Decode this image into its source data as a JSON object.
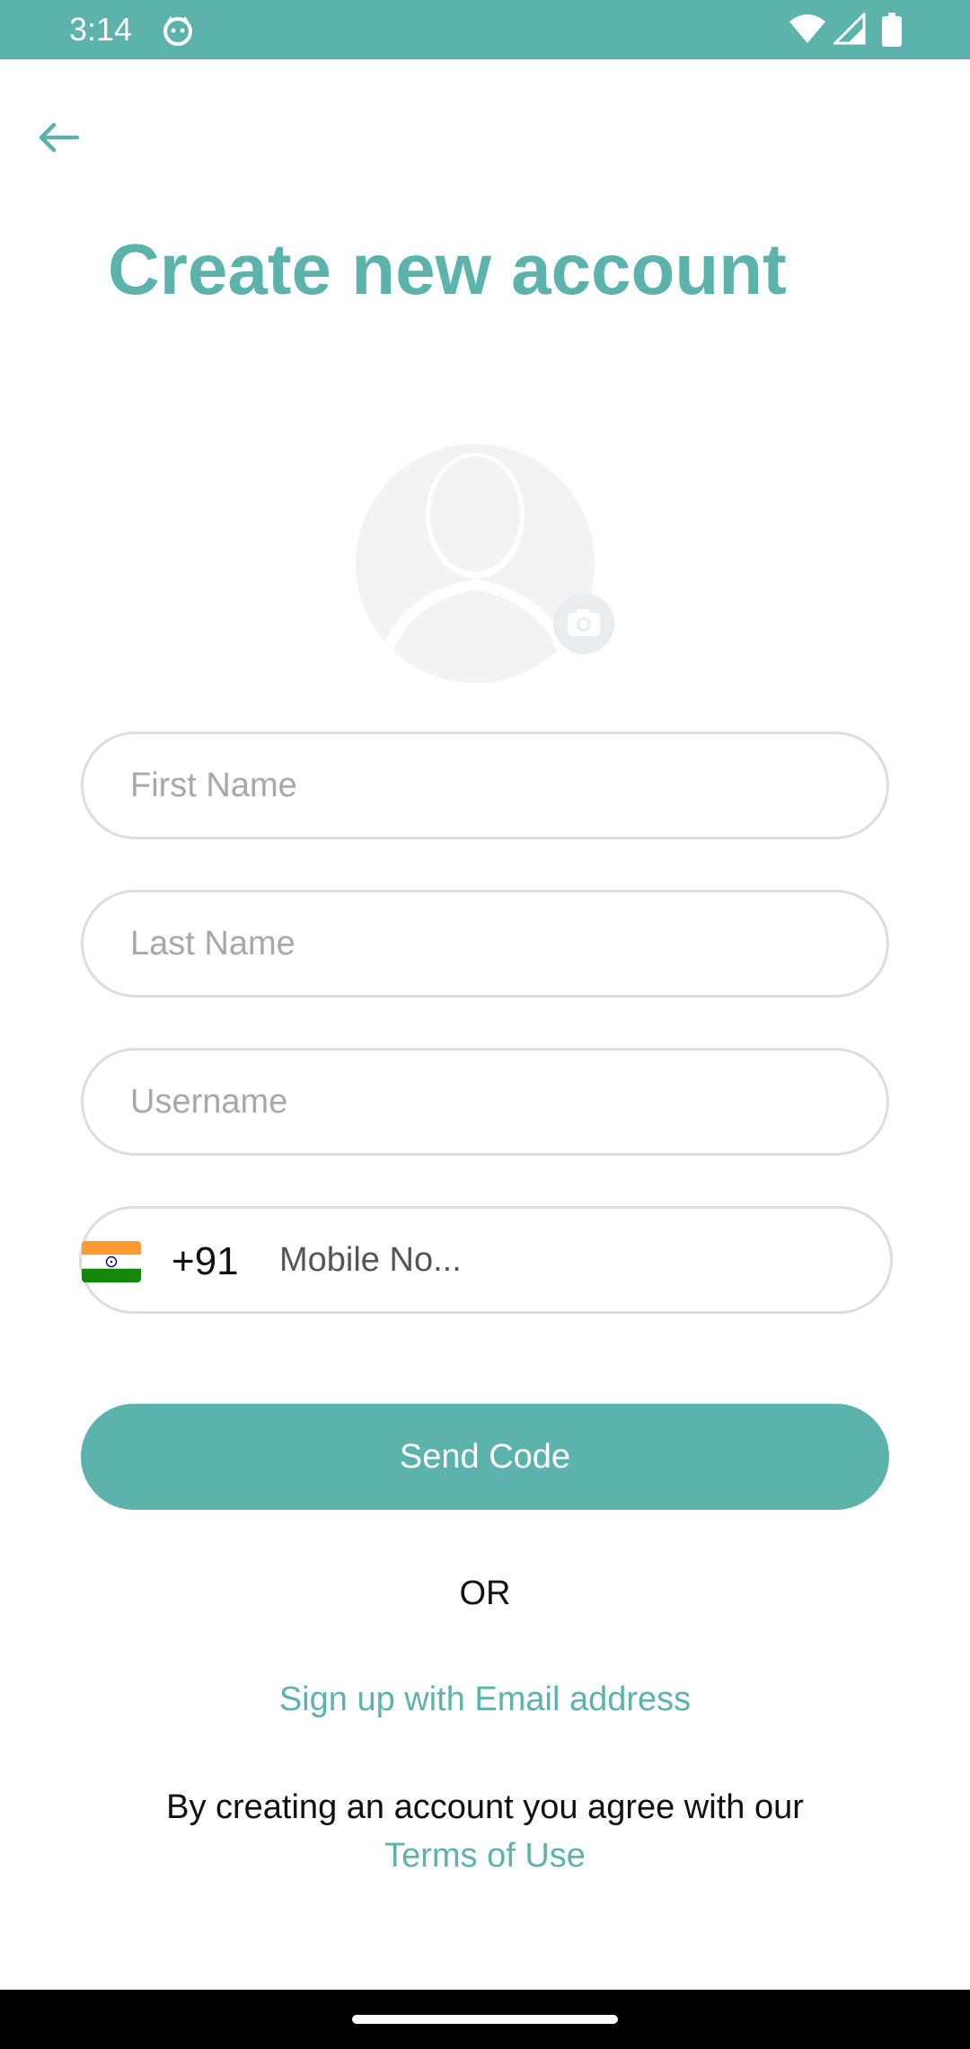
{
  "status_bar": {
    "time": "3:14",
    "app_icon": "cat-face-icon",
    "wifi_icon": "wifi-icon",
    "signal_icon": "cell-signal-icon",
    "battery_icon": "battery-icon"
  },
  "header": {
    "back_icon": "arrow-left-icon",
    "title": "Create new account"
  },
  "avatar": {
    "placeholder_icon": "user-silhouette-icon",
    "camera_icon": "camera-icon"
  },
  "form": {
    "first_name_placeholder": "First Name",
    "last_name_placeholder": "Last Name",
    "username_placeholder": "Username",
    "phone": {
      "flag_icon": "india-flag-icon",
      "country_code": "+91",
      "placeholder": "Mobile No..."
    },
    "send_button_label": "Send Code"
  },
  "alt": {
    "or_label": "OR",
    "email_link": "Sign up with Email address"
  },
  "footer": {
    "agree_text": "By creating an account you agree with our",
    "terms_link": "Terms of Use"
  },
  "colors": {
    "accent": "#5cb3ab",
    "border": "#dddddd",
    "placeholder": "#a8a8a8"
  }
}
